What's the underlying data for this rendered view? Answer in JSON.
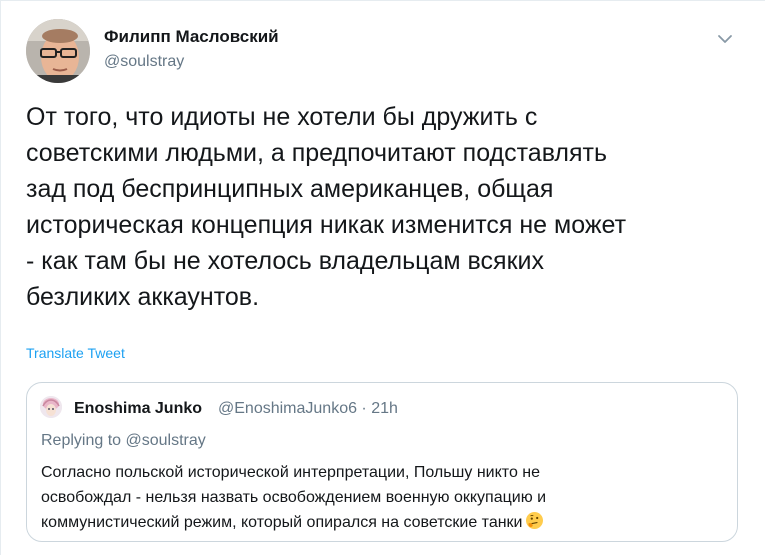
{
  "tweet": {
    "author_name": "Филипп Масловский",
    "author_handle": "@soulstray",
    "body_text": "От того, что идиоты не хотели бы дружить с\nсоветскими людьми, а предпочитают подставлять\nзад под беспринципных американцев, общая\nисторическая концепция никак изменится не может\n- как там бы не хотелось владельцам всяких\nбезликих аккаунтов.",
    "translate_label": "Translate Tweet",
    "menu_icon": "chevron-down-icon"
  },
  "quoted_tweet": {
    "author_name": "Enoshima Junko",
    "author_handle_time": "@EnoshimaJunko6 · 21h",
    "replying_to": "Replying to @soulstray",
    "body_text": "Согласно польской исторической интерпретации, Польшу никто не\nосвобождал - нельзя назвать освобождением военную оккупацию и\nкоммунистический режим, который опирался на советские танки",
    "emoji": "thinking-face-emoji"
  },
  "colors": {
    "text_primary": "#14171a",
    "text_secondary": "#657786",
    "link": "#1da1f2",
    "border": "#ccd6dd"
  }
}
